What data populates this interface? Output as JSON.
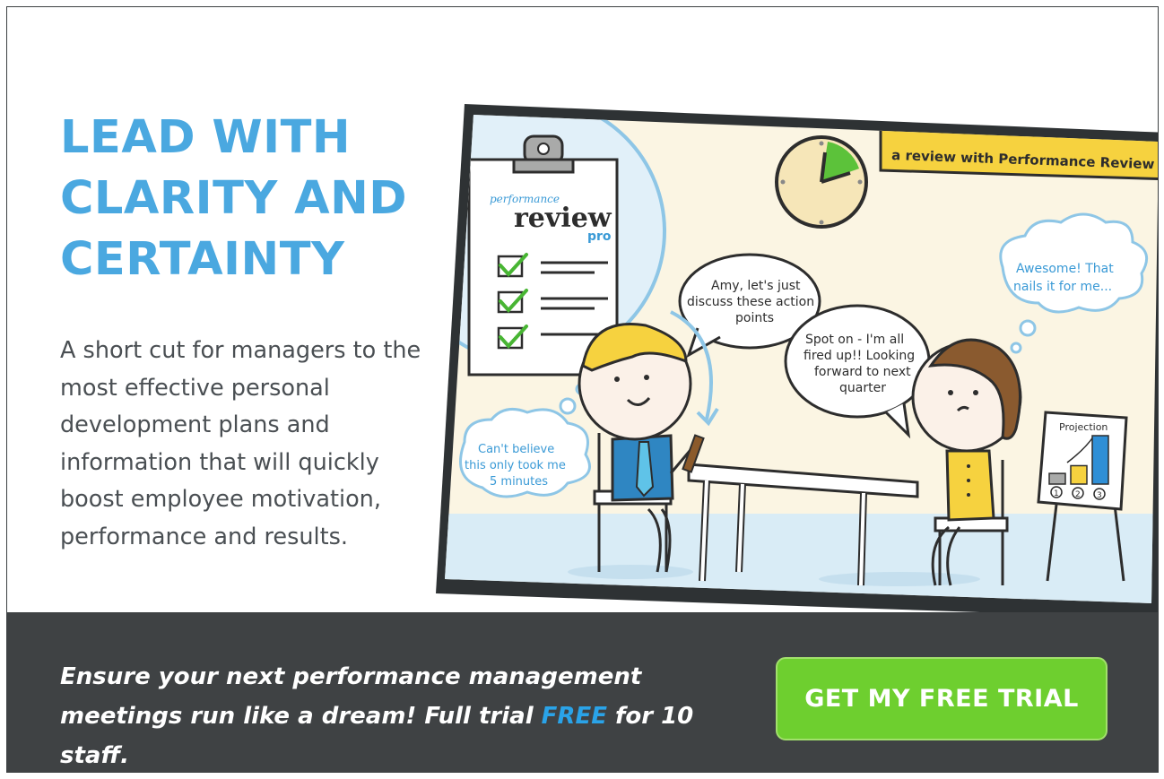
{
  "hero": {
    "headline_lines": [
      "LEAD WITH",
      "CLARITY AND",
      "CERTAINTY"
    ],
    "body": "A short cut for managers to the most effective personal development plans and information that will quickly boost employee motivation, performance and results."
  },
  "illustration": {
    "banner": "a review with Performance Review Pro",
    "clipboard": {
      "small": "performance",
      "big": "review",
      "sub": "pro"
    },
    "bubbles": {
      "manager_line1": "Amy, let's just",
      "manager_line2": "discuss these action",
      "manager_line3": "points",
      "employee_line1": "Spot on - I'm all",
      "employee_line2": "fired up!! Looking",
      "employee_line3": "forward to next",
      "employee_line4": "quarter",
      "thought_right_line1": "Awesome! That",
      "thought_right_line2": "nails it for me...",
      "thought_left_line1": "Can't believe",
      "thought_left_line2": "this only took me",
      "thought_left_line3": "5 minutes"
    },
    "flipchart": {
      "title": "Projection",
      "markers": [
        "1",
        "2",
        "3"
      ],
      "levels": [
        0.22,
        0.38,
        1.0
      ]
    }
  },
  "footer": {
    "cta_line1": "Ensure your next performance management",
    "cta_line2_pre": "meetings run like a dream! Full trial ",
    "cta_free": "FREE",
    "cta_line2_post": " for 10 staff.",
    "button_label": "GET MY FREE TRIAL"
  },
  "colors": {
    "headline": "#4aa8e0",
    "footer_bg": "#3f4244",
    "button": "#6ecf2f",
    "free_highlight": "#2aa3e8",
    "banner": "#f6d23f"
  }
}
